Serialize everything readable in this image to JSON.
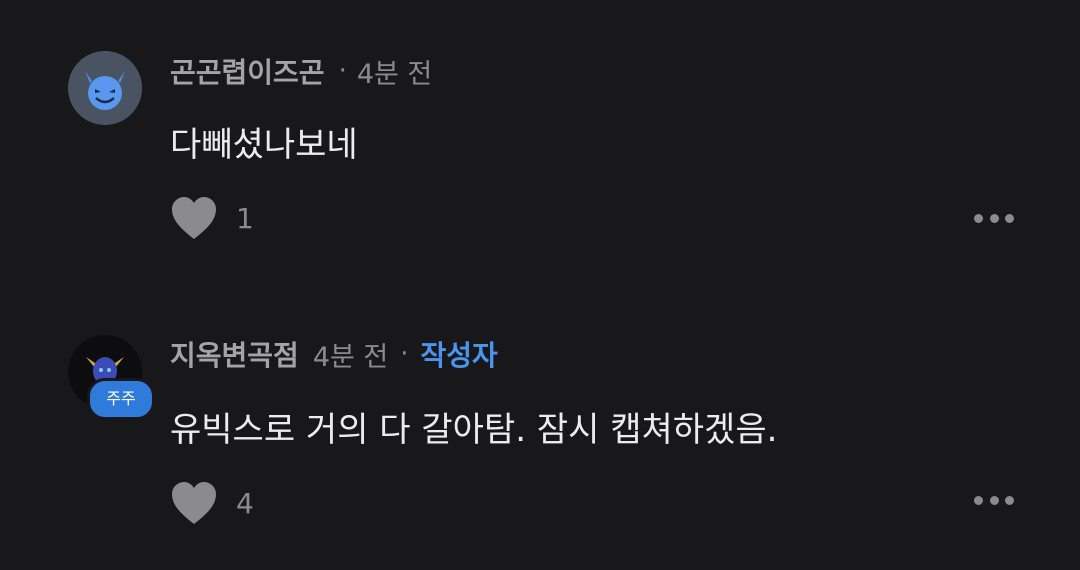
{
  "colors": {
    "background": "#18181b",
    "username": "#a3a3a8",
    "meta": "#8a8a8f",
    "body": "#ececec",
    "author_badge": "#4b94f0",
    "avatar_badge": "#2f7bdc"
  },
  "comments": [
    {
      "avatar_icon": "blue-devil-emoji-icon",
      "username": "곤곤렵이즈곤",
      "separator": "·",
      "time": "4분 전",
      "body": "다빼셨나보네",
      "like_icon": "heart-icon",
      "likes": "1",
      "more_icon": "more-options-icon"
    },
    {
      "avatar_icon": "dark-character-avatar-icon",
      "avatar_badge": "주주",
      "username": "지옥변곡점",
      "time": "4분 전",
      "separator": "·",
      "author_label": "작성자",
      "body": "유빅스로 거의 다 갈아탐. 잠시 캡쳐하겠음.",
      "like_icon": "heart-icon",
      "likes": "4",
      "more_icon": "more-options-icon"
    }
  ]
}
